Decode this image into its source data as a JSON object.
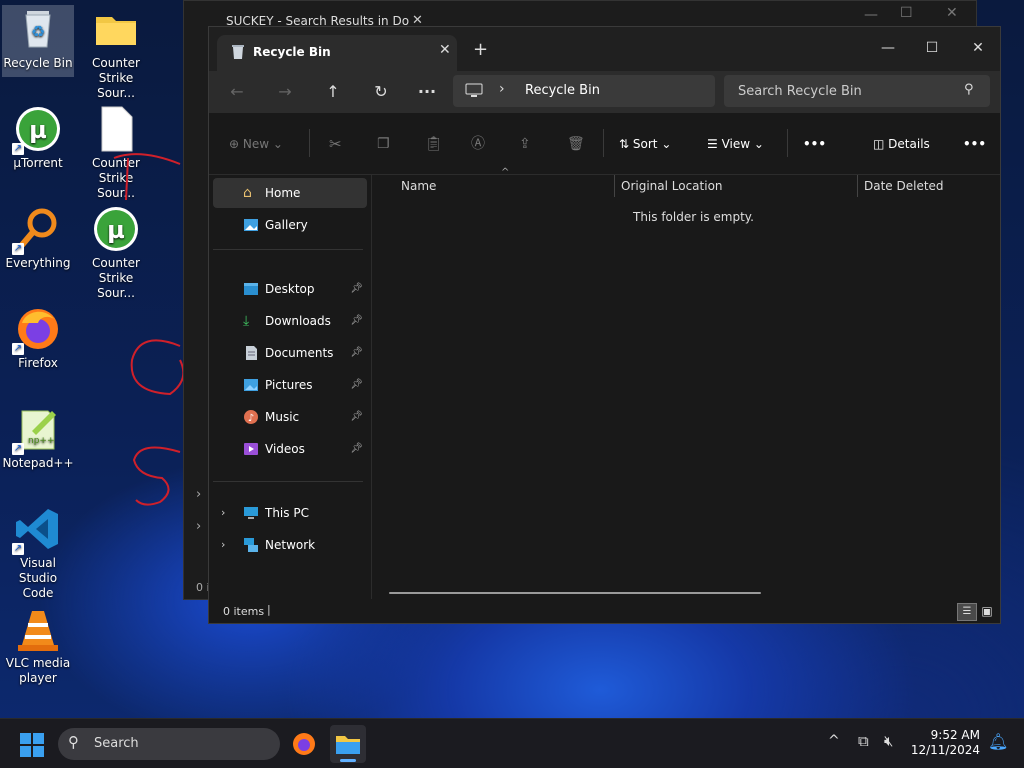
{
  "desktop": {
    "icons": [
      {
        "label": "Recycle Bin"
      },
      {
        "label": "Counter Strike Sour..."
      },
      {
        "label": "µTorrent"
      },
      {
        "label": "Counter Strike Sour..."
      },
      {
        "label": "Everything"
      },
      {
        "label": "Counter Strike Sour..."
      },
      {
        "label": "Firefox"
      },
      {
        "label": "Notepad++"
      },
      {
        "label": "Visual Studio Code"
      },
      {
        "label": "VLC media player"
      }
    ]
  },
  "back_window": {
    "tab_title": "SUCKEY - Search Results in Do",
    "status": "0 i"
  },
  "window": {
    "tab_title": "Recycle Bin",
    "address": "Recycle Bin",
    "search_placeholder": "Search Recycle Bin",
    "toolbar": {
      "new": "New",
      "sort": "Sort",
      "view": "View",
      "details": "Details",
      "more": "•••"
    },
    "sidebar": {
      "top": [
        {
          "label": "Home"
        },
        {
          "label": "Gallery"
        }
      ],
      "quick": [
        {
          "label": "Desktop"
        },
        {
          "label": "Downloads"
        },
        {
          "label": "Documents"
        },
        {
          "label": "Pictures"
        },
        {
          "label": "Music"
        },
        {
          "label": "Videos"
        }
      ],
      "tree": [
        {
          "label": "This PC"
        },
        {
          "label": "Network"
        }
      ]
    },
    "columns": [
      "Name",
      "Original Location",
      "Date Deleted"
    ],
    "empty_message": "This folder is empty.",
    "status_items": "0 items"
  },
  "taskbar": {
    "search": "Search",
    "time": "9:52 AM",
    "date": "12/11/2024"
  },
  "colors": {
    "accent": "#0078d4",
    "window_bg": "#191919",
    "taskbar_bg": "#1b1b20"
  }
}
